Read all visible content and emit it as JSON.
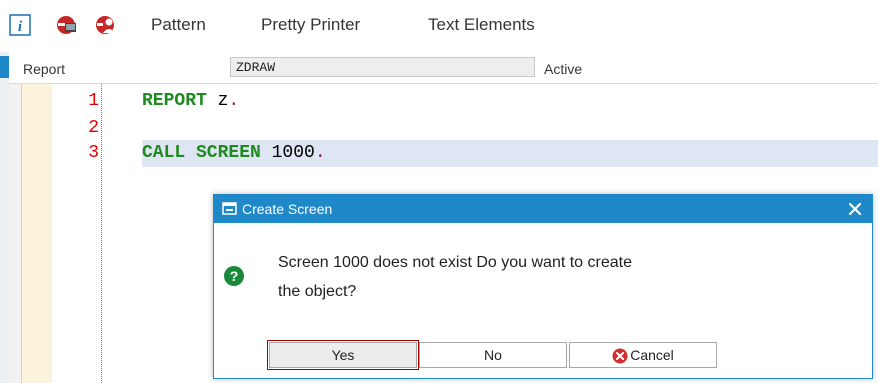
{
  "toolbar": {
    "icons": [
      "info-icon",
      "remote-compare-icon",
      "remote-user-icon"
    ],
    "pattern_label": "Pattern",
    "pretty_printer_label": "Pretty Printer",
    "text_elements_label": "Text Elements"
  },
  "header": {
    "report_label": "Report",
    "program_name": "ZDRAW",
    "status": "Active"
  },
  "editor": {
    "lines": [
      {
        "number": "1",
        "keyword": "REPORT",
        "rest": " z",
        "end": "."
      },
      {
        "number": "2",
        "keyword": "",
        "rest": "",
        "end": ""
      },
      {
        "number": "3",
        "keyword": "CALL SCREEN",
        "rest": " 1000",
        "end": "."
      }
    ]
  },
  "dialog": {
    "title": "Create Screen",
    "message_line1": "Screen 1000 does not exist Do you want to create",
    "message_line2": "the object?",
    "yes_label": "Yes",
    "no_label": "No",
    "cancel_label": "Cancel"
  },
  "colors": {
    "accent": "#1e88c9",
    "keyword": "#1f8a1f",
    "line_number": "#e00000",
    "question_icon": "#1a8a3a",
    "cancel_icon": "#d32f2f"
  }
}
